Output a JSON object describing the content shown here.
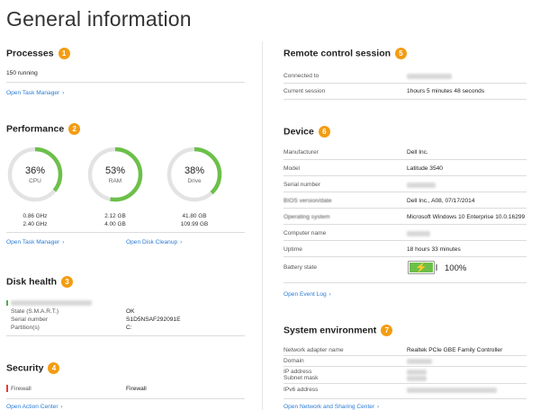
{
  "page": {
    "title": "General information"
  },
  "processes": {
    "title": "Processes",
    "badge": "1",
    "running": "150 running",
    "link": "Open Task Manager"
  },
  "performance": {
    "title": "Performance",
    "badge": "2",
    "gauges": [
      {
        "pct_label": "36%",
        "fraction": 0.36,
        "name": "CPU",
        "val1": "0.86 GHz",
        "val2": "2.40 GHz"
      },
      {
        "pct_label": "53%",
        "fraction": 0.53,
        "name": "RAM",
        "val1": "2.12 GB",
        "val2": "4.00 GB"
      },
      {
        "pct_label": "38%",
        "fraction": 0.38,
        "name": "Drive",
        "val1": "41.80 GB",
        "val2": "109.99 GB"
      }
    ],
    "link1": "Open Task Manager",
    "link2": "Open Disk Cleanup",
    "gauge_color": "#6cc04a",
    "track_color": "#e3e3e3"
  },
  "disk_health": {
    "title": "Disk health",
    "badge": "3",
    "rows": [
      {
        "label": "State (S.M.A.R.T.)",
        "value": "OK"
      },
      {
        "label": "Serial number",
        "value": "S1D5NSAF292091E"
      },
      {
        "label": "Partition(s)",
        "value": "C:"
      }
    ]
  },
  "security": {
    "title": "Security",
    "badge": "4",
    "row_label": "Firewall",
    "row_value": "Firewall",
    "link": "Open Action Center"
  },
  "remote": {
    "title": "Remote control session",
    "badge": "5",
    "rows": [
      {
        "label": "Connected to",
        "value": ""
      },
      {
        "label": "Current session",
        "value": "1hours 5 minutes 48 seconds"
      }
    ]
  },
  "device": {
    "title": "Device",
    "badge": "6",
    "rows": [
      {
        "label": "Manufacturer",
        "value": "Dell Inc."
      },
      {
        "label": "Model",
        "value": "Latitude 3540"
      },
      {
        "label": "Serial number",
        "value": ""
      },
      {
        "label": "BIOS version/date",
        "value": "Dell Inc., A08, 07/17/2014"
      },
      {
        "label": "Operating system",
        "value": "Microsoft Windows 10 Enterprise 10.0.16299"
      },
      {
        "label": "Computer name",
        "value": ""
      },
      {
        "label": "Uptime",
        "value": "18 hours 33 minutes"
      },
      {
        "label": "Battery state",
        "value": "100%"
      }
    ],
    "battery_level": 1.0,
    "link": "Open Event Log"
  },
  "system_env": {
    "title": "System environment",
    "badge": "7",
    "rows": [
      {
        "label": "Network adapter name",
        "value": "Realtek PCIe GBE Family Controller"
      },
      {
        "label": "Domain",
        "value": ""
      },
      {
        "label": "IP address",
        "value": ""
      },
      {
        "label": "Subnet mask",
        "value": ""
      },
      {
        "label": "IPv6 address",
        "value": ""
      }
    ],
    "link": "Open Network and Sharing Center"
  }
}
